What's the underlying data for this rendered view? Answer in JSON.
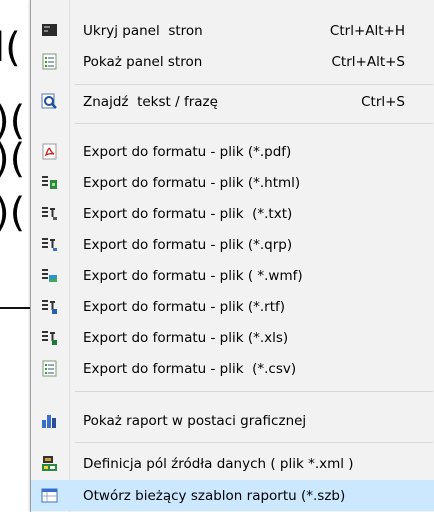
{
  "background": {
    "fragments": [
      "l(",
      ")(",
      ")(",
      ")("
    ]
  },
  "menu": {
    "items": [
      {
        "label": "Ukryj panel  stron",
        "shortcut": "Ctrl+Alt+H",
        "icon": "panel-dark-icon"
      },
      {
        "label": "Pokaż panel stron",
        "shortcut": "Ctrl+Alt+S",
        "icon": "panel-list-icon"
      },
      {
        "label": "Znajdź  tekst / frazę",
        "shortcut": "Ctrl+S",
        "icon": "find-magnifier-icon"
      },
      {
        "label": "Export do formatu - plik (*.pdf)",
        "shortcut": "",
        "icon": "pdf-icon"
      },
      {
        "label": "Export do formatu - plik (*.html)",
        "shortcut": "",
        "icon": "html-export-icon"
      },
      {
        "label": "Export do formatu - plik  (*.txt)",
        "shortcut": "",
        "icon": "txt-export-icon"
      },
      {
        "label": "Export do formatu - plik (*.qrp)",
        "shortcut": "",
        "icon": "qrp-export-icon"
      },
      {
        "label": "Export do formatu - plik ( *.wmf)",
        "shortcut": "",
        "icon": "wmf-export-icon"
      },
      {
        "label": "Export do formatu - plik (*.rtf)",
        "shortcut": "",
        "icon": "rtf-export-icon"
      },
      {
        "label": "Export do formatu - plik (*.xls)",
        "shortcut": "",
        "icon": "xls-export-icon"
      },
      {
        "label": "Export do formatu - plik  (*.csv)",
        "shortcut": "",
        "icon": "csv-export-icon"
      },
      {
        "label": "Pokaż raport w postaci graficznej",
        "shortcut": "",
        "icon": "bar-chart-icon"
      },
      {
        "label": "Definicja pól źródła danych ( plik *.xml )",
        "shortcut": "",
        "icon": "data-definition-icon"
      },
      {
        "label": "Otwórz bieżący szablon raportu (*.szb)",
        "shortcut": "",
        "icon": "template-window-icon"
      }
    ],
    "highlighted_index": 13
  },
  "colors": {
    "menu_bg": "#f2f2f2",
    "highlight": "#cce8ff",
    "separator": "#d7d7d7"
  }
}
